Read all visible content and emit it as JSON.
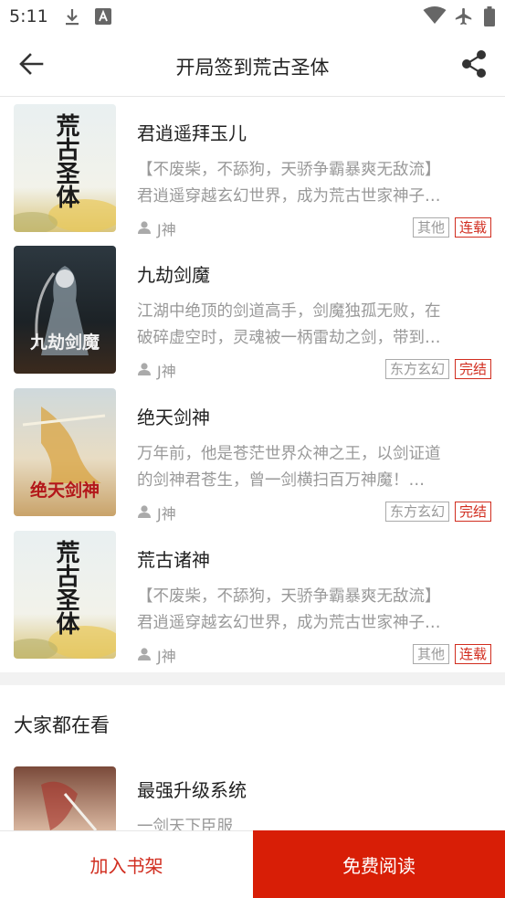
{
  "status_bar": {
    "time": "5:11"
  },
  "header": {
    "title": "开局签到荒古圣体"
  },
  "books": [
    {
      "title": "君逍遥拜玉儿",
      "desc_line1": "【不废柴，不舔狗，天骄争霸暴爽无敌流】",
      "desc_line2": "君逍遥穿越玄幻世界，成为荒古世家神子…",
      "author": "J神",
      "category": "其他",
      "status": "连载",
      "cover_text": "荒古圣体"
    },
    {
      "title": "九劫剑魔",
      "desc_line1": "江湖中绝顶的剑道高手，剑魔独孤无败，在",
      "desc_line2": "破碎虚空时，灵魂被一柄雷劫之剑，带到…",
      "author": "J神",
      "category": "东方玄幻",
      "status": "完结",
      "cover_text": "九劫剑魔"
    },
    {
      "title": "绝天剑神",
      "desc_line1": "万年前，他是苍茫世界众神之王，以剑证道",
      "desc_line2": "的剑神君苍生，曾一剑横扫百万神魔！…",
      "author": "J神",
      "category": "东方玄幻",
      "status": "完结",
      "cover_text": "绝天剑神"
    },
    {
      "title": "荒古诸神",
      "desc_line1": "【不废柴，不舔狗，天骄争霸暴爽无敌流】",
      "desc_line2": "君逍遥穿越玄幻世界，成为荒古世家神子…",
      "author": "J神",
      "category": "其他",
      "status": "连载",
      "cover_text": "荒古圣体"
    }
  ],
  "recommend": {
    "section_title": "大家都在看",
    "book": {
      "title": "最强升级系统",
      "desc": "一剑天下臣服"
    }
  },
  "bottom": {
    "shelf_label": "加入书架",
    "read_label": "免费阅读"
  },
  "colors": {
    "accent": "#d81e06",
    "tag_red": "#d12d1f"
  },
  "icons": {
    "back": "arrow-left-icon",
    "share": "share-icon",
    "author": "person-icon",
    "status": [
      "download-icon",
      "font-icon",
      "wifi-icon",
      "airplane-icon",
      "battery-icon"
    ]
  }
}
